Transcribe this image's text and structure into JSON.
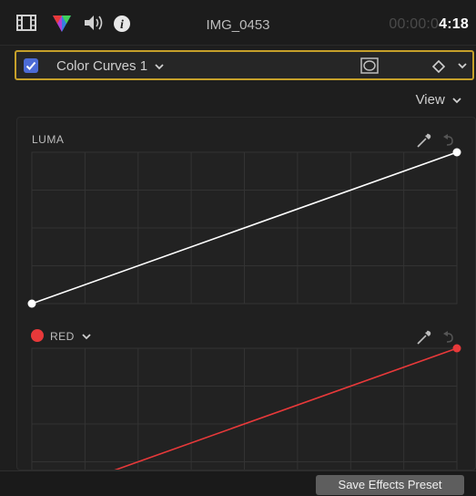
{
  "header": {
    "title": "IMG_0453",
    "timecode_dim": "00:00:0",
    "timecode_lit": "4:18",
    "icons": [
      "film-icon",
      "color-prism-icon",
      "speaker-icon",
      "info-icon"
    ]
  },
  "effect": {
    "name": "Color Curves 1",
    "enabled": true,
    "accent_color": "#c6a02a",
    "checkbox_color": "#4c6bd6"
  },
  "view_button": {
    "label": "View"
  },
  "curves": [
    {
      "label": "LUMA",
      "color": "#ffffff"
    },
    {
      "label": "RED",
      "color": "#e8393a"
    }
  ],
  "footer": {
    "save_preset_label": "Save Effects Preset"
  }
}
